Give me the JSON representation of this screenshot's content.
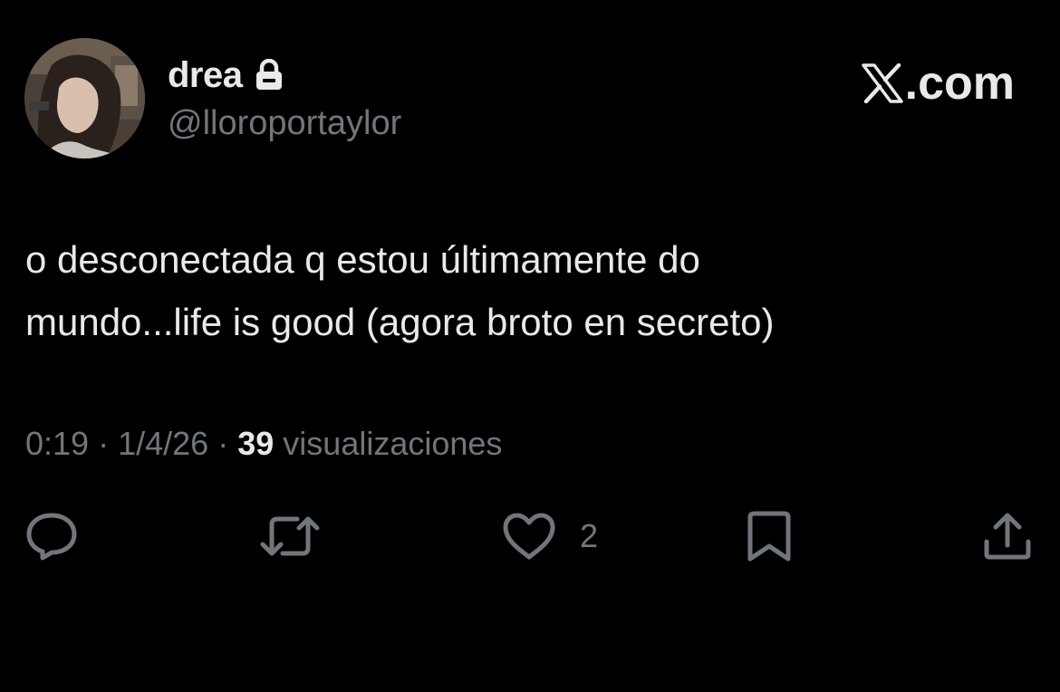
{
  "profile": {
    "display_name": "drea",
    "handle": "@lloroportaylor",
    "protected_icon": "lock-icon",
    "avatar": "profile-photo"
  },
  "brand": {
    "logo_icon": "x-logo-icon",
    "text": ".com"
  },
  "tweet": {
    "text_lines": [
      "o desconectada q estou últimamente do",
      "mundo...life is good (agora broto en secreto)"
    ],
    "time": "0:19",
    "separator": "·",
    "date": "1/4/26",
    "views_count": "39",
    "views_label": "visualizaciones"
  },
  "actions": {
    "reply_icon": "reply-icon",
    "retweet_icon": "retweet-icon",
    "like_icon": "heart-icon",
    "like_count": "2",
    "bookmark_icon": "bookmark-icon",
    "share_icon": "share-icon"
  },
  "colors": {
    "background": "#000000",
    "primary_text": "#e7e9ea",
    "secondary_text": "#71767b"
  }
}
